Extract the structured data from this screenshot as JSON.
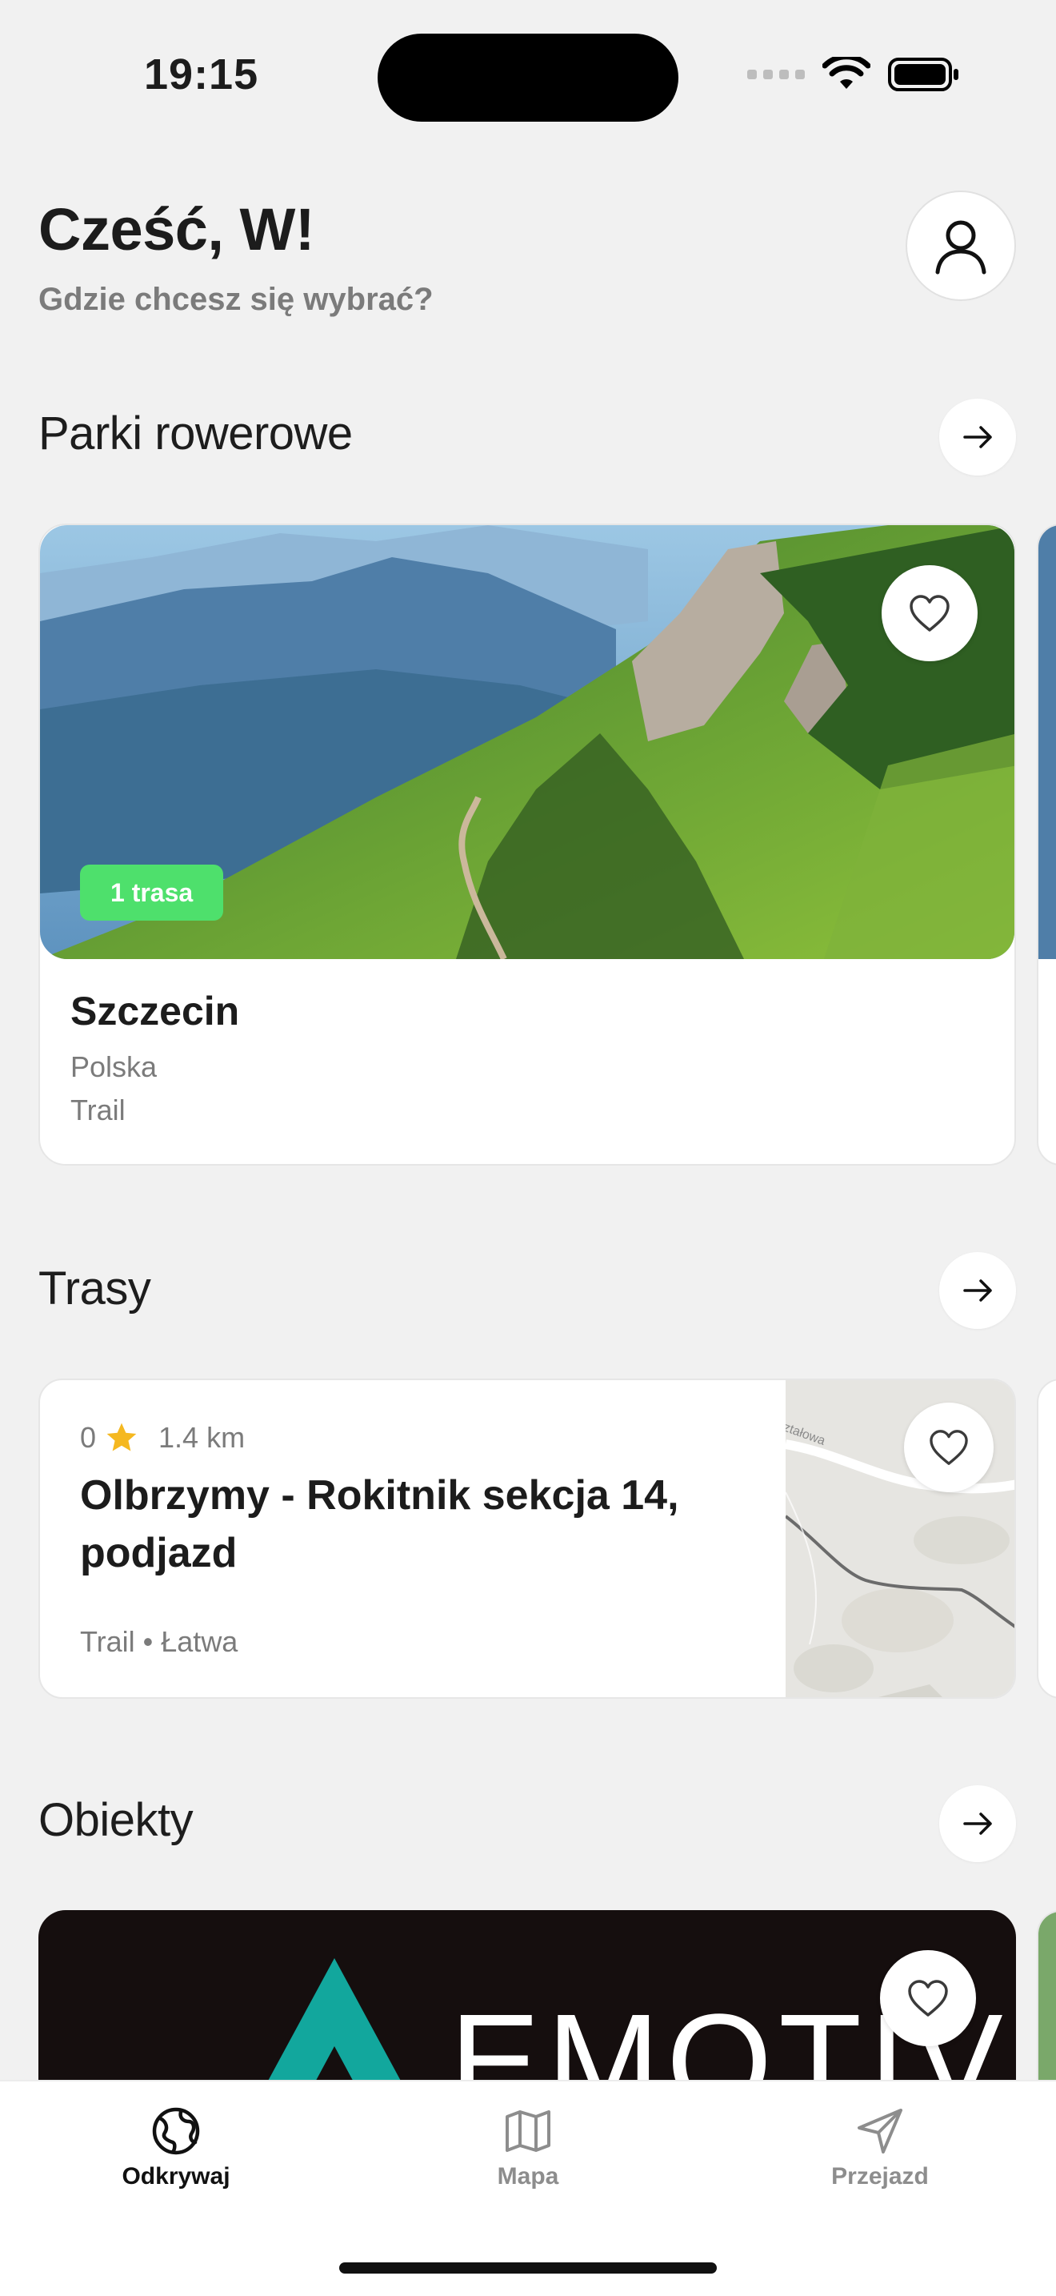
{
  "status_bar": {
    "time": "19:15"
  },
  "header": {
    "greeting": "Cześć, W!",
    "subtitle": "Gdzie chcesz się wybrać?"
  },
  "sections": {
    "parks": {
      "title": "Parki rowerowe",
      "card": {
        "badge": "1 trasa",
        "name": "Szczecin",
        "country": "Polska",
        "type": "Trail"
      }
    },
    "routes": {
      "title": "Trasy",
      "card": {
        "rating": "0",
        "distance": "1.4 km",
        "name": "Olbrzymy - Rokitnik sekcja 14, podjazd",
        "tags": "Trail • Łatwa",
        "map_label": "ztałowa"
      }
    },
    "objects": {
      "title": "Obiekty",
      "card": {
        "name": "EMOTIV"
      }
    }
  },
  "tabbar": {
    "tabs": [
      {
        "label": "Odkrywaj",
        "icon": "globe-icon",
        "active": true
      },
      {
        "label": "Mapa",
        "icon": "map-icon",
        "active": false
      },
      {
        "label": "Przejazd",
        "icon": "navigation-icon",
        "active": false
      }
    ]
  },
  "colors": {
    "background": "#f1f1f1",
    "badge_green": "#4ee06c",
    "star": "#f5b820",
    "object_bg": "#150e0e",
    "object_accent": "#12a79d"
  }
}
